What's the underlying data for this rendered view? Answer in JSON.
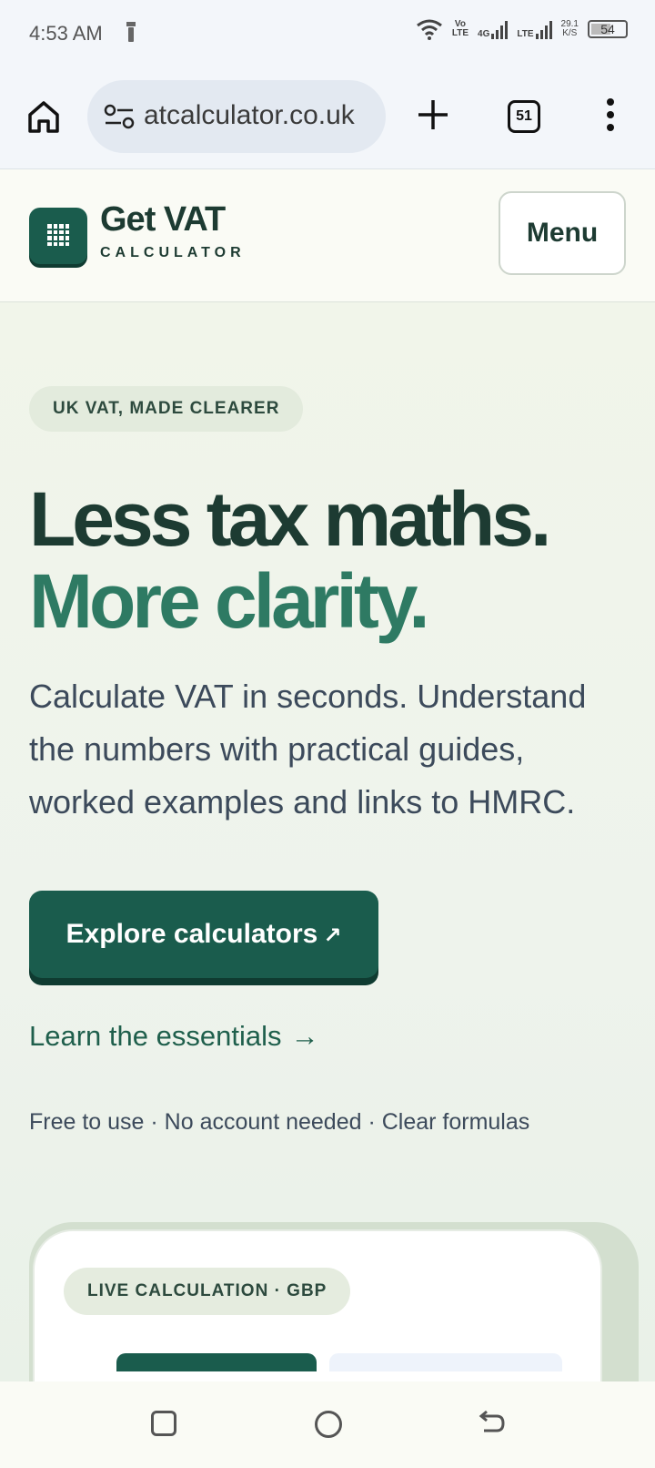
{
  "status_bar": {
    "time": "4:53 AM",
    "net1": "Vo\nLTE",
    "net2": "4G",
    "net3": "LTE",
    "speed": "29.1\nK/S",
    "battery": "54"
  },
  "browser": {
    "url": "atcalculator.co.uk",
    "tab_count": "51"
  },
  "header": {
    "brand_name": "Get VAT",
    "brand_sub": "CALCULATOR",
    "menu_label": "Menu"
  },
  "hero": {
    "pill": "UK VAT, MADE CLEARER",
    "headline_1": "Less tax maths.",
    "headline_2": "More clarity.",
    "lead": "Calculate VAT in seconds. Understand the numbers with practical guides, worked examples and links to HMRC.",
    "cta_label": "Explore calculators",
    "cta_arrow": "↗",
    "learn_label": "Learn the essentials",
    "learn_arrow": "→",
    "trust_line": "Free to use · No account needed · Clear formulas"
  },
  "card": {
    "pill": "LIVE CALCULATION · GBP"
  },
  "colors": {
    "brand": "#1a5c4d",
    "accent": "#2e7a63",
    "heading": "#1d3b32"
  }
}
